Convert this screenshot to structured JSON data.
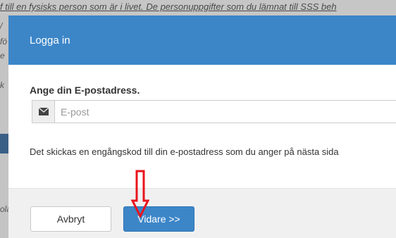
{
  "background": {
    "top_text": "f till en fysisks person som är i livet. De personuppgifter som du lämnat till SSS beh",
    "fragments": [
      "/",
      "fö",
      "e",
      "k",
      "ö",
      "ola"
    ]
  },
  "modal": {
    "title": "Logga in",
    "email_label": "Ange din E-postadress.",
    "email_placeholder": "E-post",
    "email_value": "",
    "info_text": "Det skickas en engångskod till din e-postadress som du anger på nästa sida",
    "cancel_label": "Avbryt",
    "next_label": "Vidare >>"
  },
  "colors": {
    "header": "#3c86c8",
    "primary_button": "#3c86c8",
    "annotation_arrow": "#e8141c"
  },
  "icons": {
    "email_addon": "envelope-icon",
    "annotation": "down-arrow-annotation-icon"
  }
}
